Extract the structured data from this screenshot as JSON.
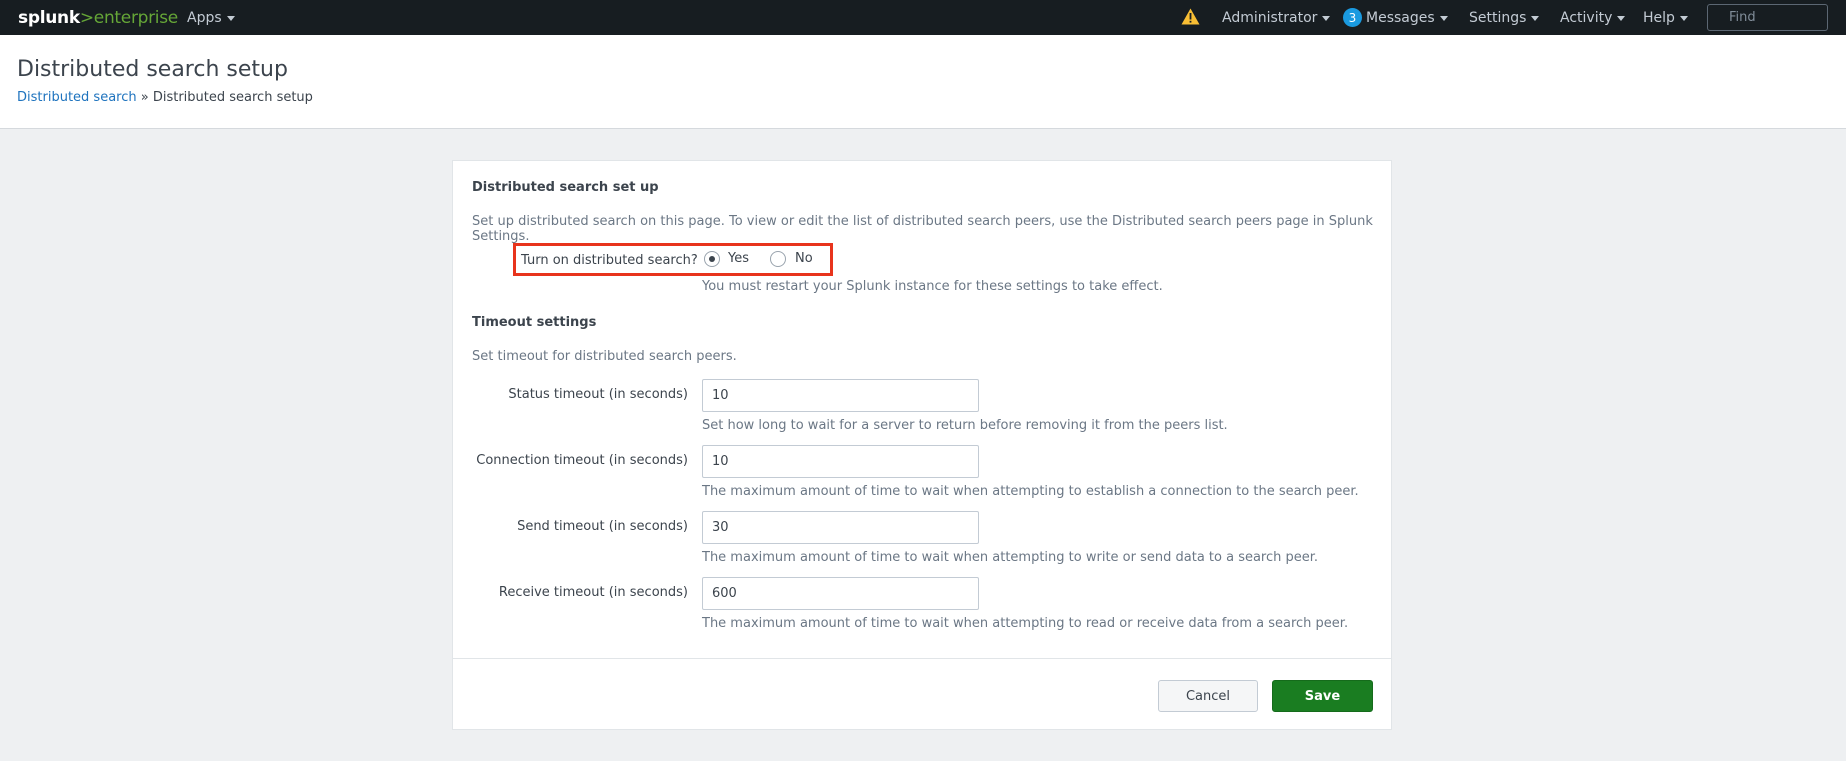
{
  "topbar": {
    "logo_part1": "splunk",
    "logo_part2": ">",
    "logo_part3": "enterprise",
    "apps_label": "Apps",
    "admin_label": "Administrator",
    "messages_count": "3",
    "messages_label": "Messages",
    "settings_label": "Settings",
    "activity_label": "Activity",
    "help_label": "Help",
    "find_placeholder": "Find"
  },
  "header": {
    "title": "Distributed search setup",
    "breadcrumb_link": "Distributed search",
    "breadcrumb_sep": " » ",
    "breadcrumb_current": "Distributed search setup"
  },
  "setup": {
    "title": "Distributed search set up",
    "description": "Set up distributed search on this page. To view or edit the list of distributed search peers, use the Distributed search peers page in Splunk Settings.",
    "toggle_label": "Turn on distributed search?",
    "yes_label": "Yes",
    "no_label": "No",
    "selected": "Yes",
    "restart_note": "You must restart your Splunk instance for these settings to take effect."
  },
  "timeout": {
    "title": "Timeout settings",
    "description": "Set timeout for distributed search peers.",
    "fields": [
      {
        "label": "Status timeout (in seconds)",
        "value": "10",
        "help": "Set how long to wait for a server to return before removing it from the peers list."
      },
      {
        "label": "Connection timeout (in seconds)",
        "value": "10",
        "help": "The maximum amount of time to wait when attempting to establish a connection to the search peer."
      },
      {
        "label": "Send timeout (in seconds)",
        "value": "30",
        "help": "The maximum amount of time to wait when attempting to write or send data to a search peer."
      },
      {
        "label": "Receive timeout (in seconds)",
        "value": "600",
        "help": "The maximum amount of time to wait when attempting to read or receive data from a search peer."
      }
    ]
  },
  "footer": {
    "cancel_label": "Cancel",
    "save_label": "Save"
  },
  "colors": {
    "topbar_bg": "#171d21",
    "brand_green": "#65a637",
    "save_green": "#1a7d21",
    "link_blue": "#1e73be",
    "highlight_red": "#e8341c",
    "badge_blue": "#1a9ae0"
  }
}
